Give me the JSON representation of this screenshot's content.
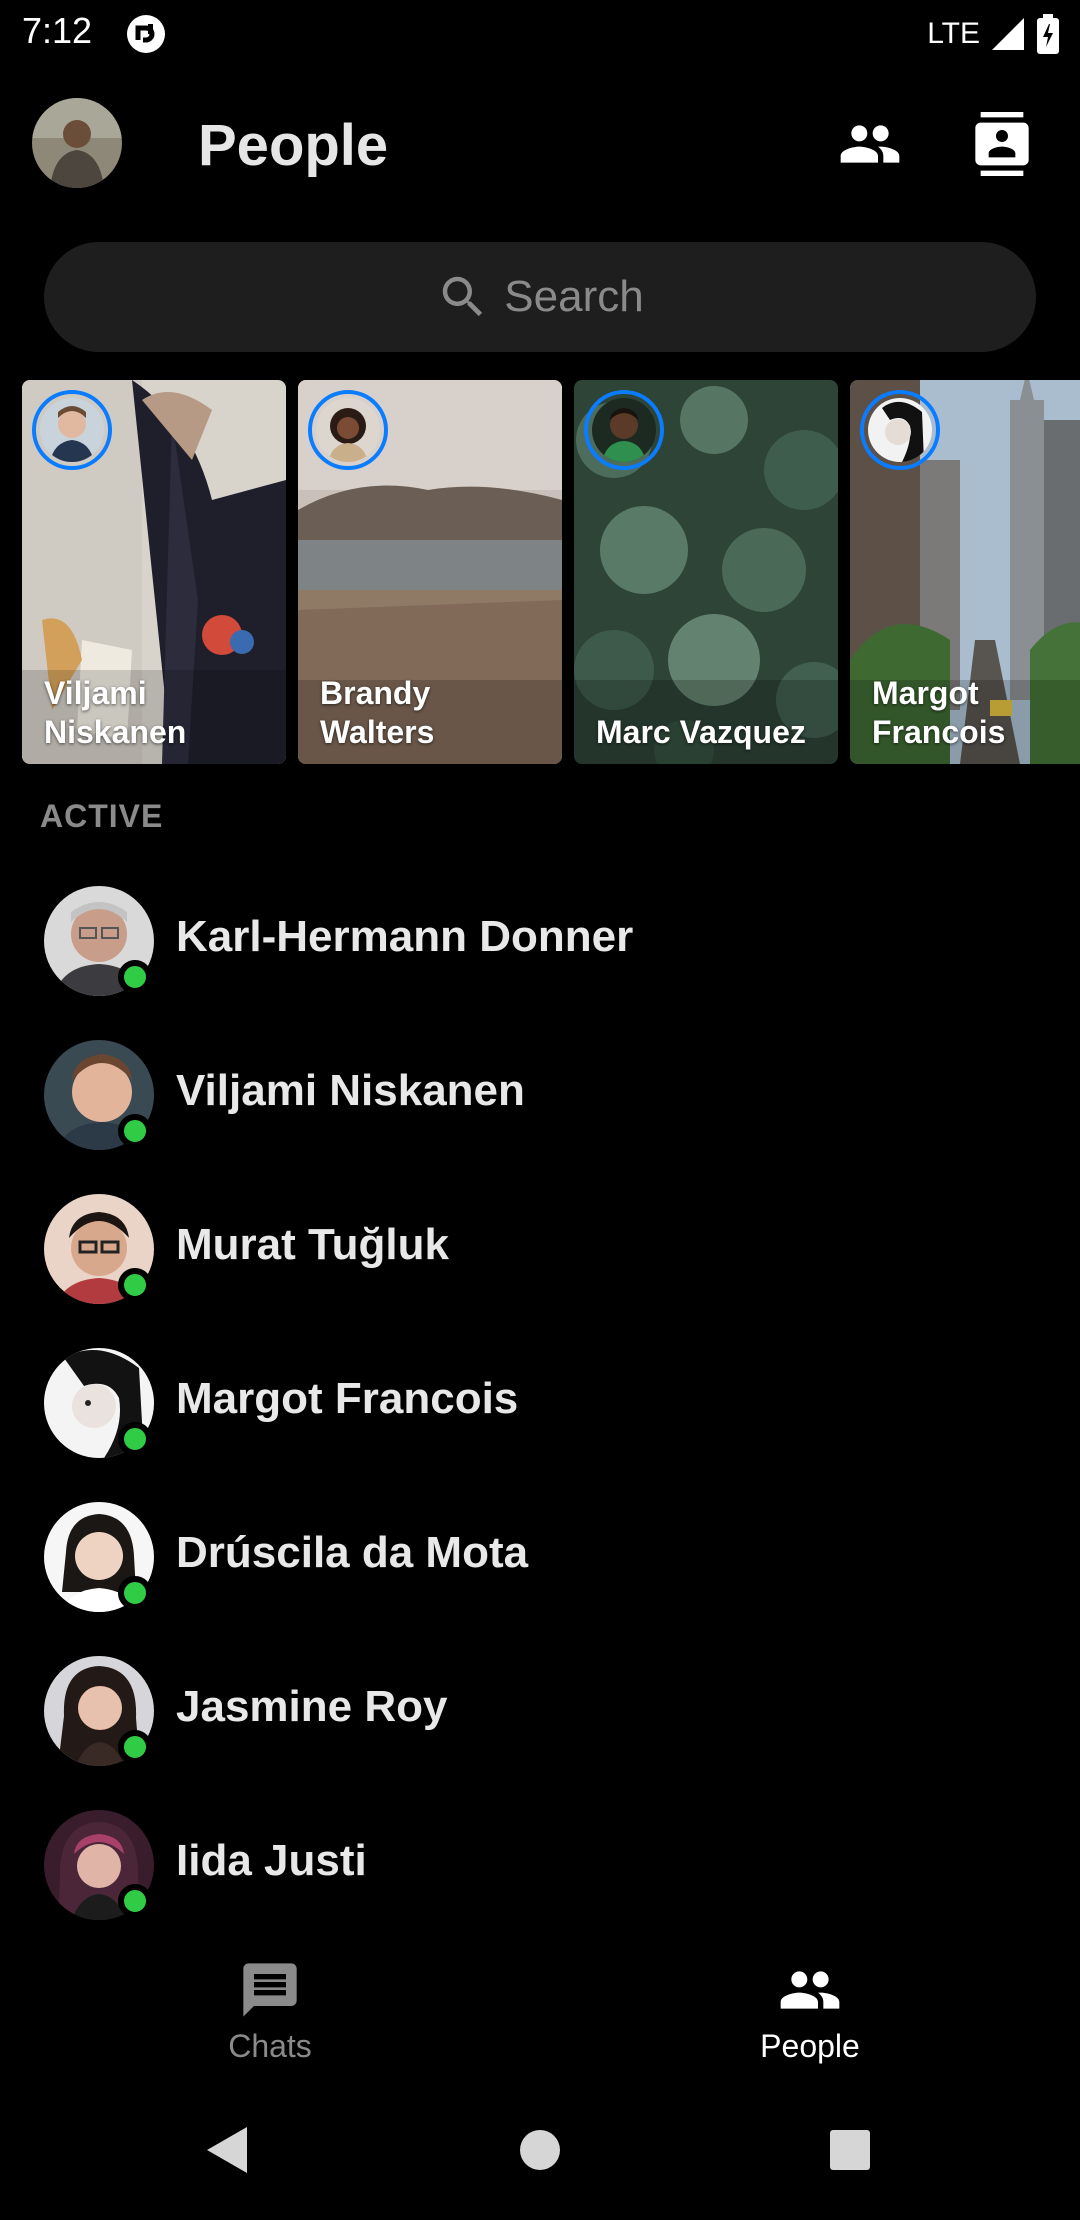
{
  "status": {
    "time": "7:12",
    "network": "LTE"
  },
  "header": {
    "title": "People"
  },
  "search": {
    "placeholder": "Search"
  },
  "stories": [
    {
      "name": "Viljami Niskanen"
    },
    {
      "name": "Brandy Walters"
    },
    {
      "name": "Marc Vazquez"
    },
    {
      "name": "Margot Francois"
    }
  ],
  "active_section": {
    "label": "ACTIVE"
  },
  "people": [
    {
      "name": "Karl-Hermann Donner",
      "online": true
    },
    {
      "name": "Viljami Niskanen",
      "online": true
    },
    {
      "name": "Murat Tuğluk",
      "online": true
    },
    {
      "name": "Margot Francois",
      "online": true
    },
    {
      "name": "Drúscila da Mota",
      "online": true
    },
    {
      "name": "Jasmine Roy",
      "online": true
    },
    {
      "name": "Iida Justi",
      "online": true
    }
  ],
  "bottom_nav": {
    "chats_label": "Chats",
    "people_label": "People",
    "active_tab": "People"
  },
  "colors": {
    "accent": "#0a7cff",
    "online": "#31cc46",
    "inactive": "#8a8a8a"
  },
  "icons": [
    "app-notification-icon",
    "signal-icon",
    "battery-icon",
    "people-icon",
    "contacts-icon",
    "search-icon",
    "chats-icon",
    "back-icon",
    "home-icon",
    "recents-icon"
  ]
}
